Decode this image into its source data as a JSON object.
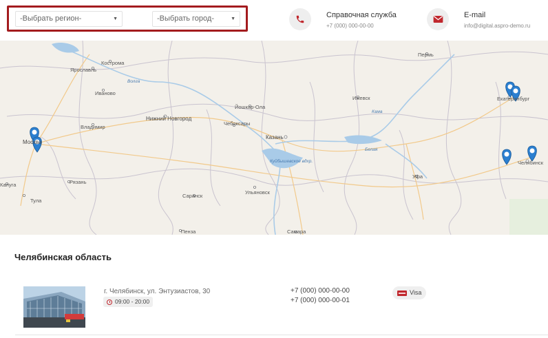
{
  "selectors": {
    "region_label": "-Выбрать регион-",
    "city_label": "-Выбрать город-"
  },
  "contacts": {
    "phone": {
      "title": "Справочная служба",
      "value": "+7 (000) 000-00-00",
      "icon": "phone-icon"
    },
    "email": {
      "title": "E-mail",
      "value": "info@digital.aspro-demo.ru",
      "icon": "envelope-icon"
    }
  },
  "map": {
    "cities": [
      {
        "name": "Москва"
      },
      {
        "name": "Ярославль"
      },
      {
        "name": "Кострома"
      },
      {
        "name": "Иваново"
      },
      {
        "name": "Владимир"
      },
      {
        "name": "Нижний Новгород"
      },
      {
        "name": "Рязань"
      },
      {
        "name": "Тула"
      },
      {
        "name": "Калуга"
      },
      {
        "name": "Саранск"
      },
      {
        "name": "Пенза"
      },
      {
        "name": "Чебоксары"
      },
      {
        "name": "Йошкар-Ола"
      },
      {
        "name": "Казань"
      },
      {
        "name": "Ульяновск"
      },
      {
        "name": "Самара"
      },
      {
        "name": "Ижевск"
      },
      {
        "name": "Пермь"
      },
      {
        "name": "Уфа"
      },
      {
        "name": "Екатеринбург"
      },
      {
        "name": "Челябинск"
      }
    ],
    "rivers": [
      {
        "name": "Волга"
      },
      {
        "name": "Кама"
      },
      {
        "name": "Белая"
      },
      {
        "name": "Куйбышевское вдхр."
      }
    ],
    "pin_count": 6
  },
  "region": {
    "title": "Челябинская область",
    "offices": [
      {
        "address": "г. Челябинск, ул. Энтузиастов, 30",
        "hours": "09:00 - 20:00",
        "phones": [
          "+7 (000) 000-00-00",
          "+7 (000) 000-00-01"
        ],
        "payment": "Visa"
      }
    ]
  },
  "colors": {
    "accent": "#c0272d",
    "frame": "#a31b1e",
    "water": "#a9cbe8",
    "pin": "#2b7fd0"
  }
}
